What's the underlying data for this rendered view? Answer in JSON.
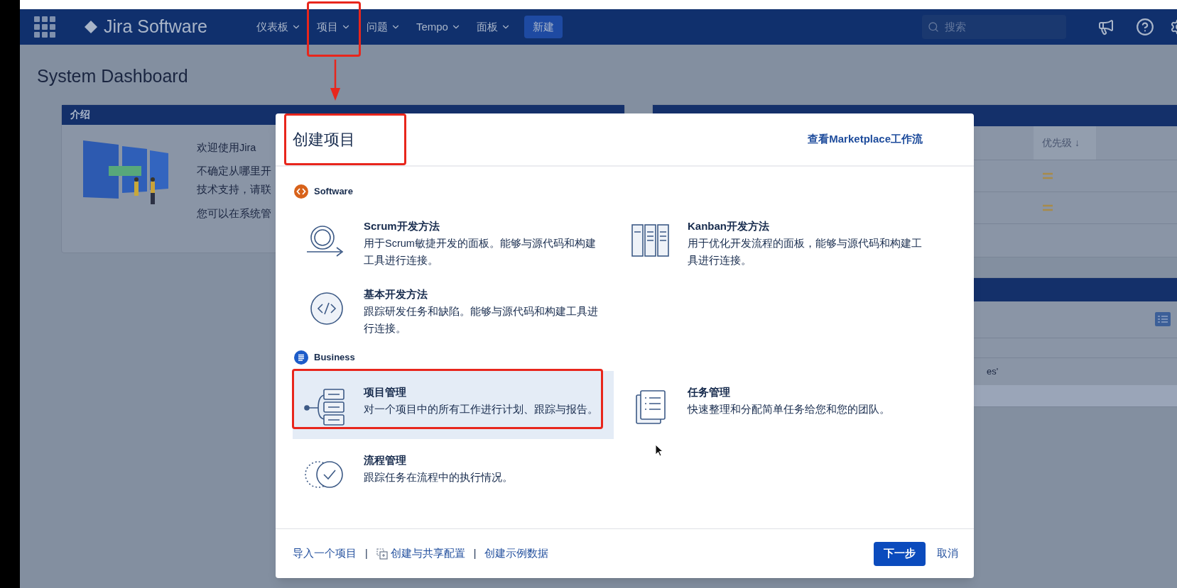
{
  "nav": {
    "app_name": "Jira Software",
    "menus": [
      "仪表板",
      "项目",
      "问题",
      "Tempo",
      "面板"
    ],
    "create_button": "新建",
    "search": {
      "placeholder": "搜索"
    }
  },
  "page": {
    "title": "System Dashboard"
  },
  "intro_card": {
    "title": "介绍",
    "heading": "欢迎使用Jira",
    "lines": [
      "不确定从哪里开",
      "技术支持，请联",
      "您可以在系统管"
    ]
  },
  "issues_card": {
    "column": "优先级 ↓",
    "rows": [
      {
        "kind": "medium"
      },
      {
        "kind": "medium"
      }
    ]
  },
  "activity_card": {
    "snippet": "es'"
  },
  "modal": {
    "title": "创建项目",
    "marketplace_link": "查看Marketplace工作流",
    "sections": [
      {
        "label": "Software",
        "kind": "software",
        "templates": [
          {
            "kind": "scrum",
            "name": "Scrum开发方法",
            "description": "用于Scrum敏捷开发的面板。能够与源代码和构建工具进行连接。",
            "selected": false
          },
          {
            "kind": "kanban",
            "name": "Kanban开发方法",
            "description": "用于优化开发流程的面板，能够与源代码和构建工具进行连接。",
            "selected": false
          },
          {
            "kind": "basic",
            "name": "基本开发方法",
            "description": "跟踪研发任务和缺陷。能够与源代码和构建工具进行连接。",
            "selected": false
          }
        ]
      },
      {
        "label": "Business",
        "kind": "business",
        "templates": [
          {
            "kind": "project",
            "name": "项目管理",
            "description": "对一个项目中的所有工作进行计划、跟踪与报告。",
            "selected": true
          },
          {
            "kind": "task",
            "name": "任务管理",
            "description": "快速整理和分配简单任务给您和您的团队。",
            "selected": false
          },
          {
            "kind": "process",
            "name": "流程管理",
            "description": "跟踪任务在流程中的执行情况。",
            "selected": false
          }
        ]
      }
    ],
    "footer_links": [
      {
        "kind": "link",
        "label": "导入一个项目"
      },
      {
        "kind": "separator",
        "label": "|"
      },
      {
        "kind": "config",
        "label": "创建与共享配置"
      },
      {
        "kind": "separator",
        "label": "|"
      },
      {
        "kind": "link",
        "label": "创建示例数据"
      }
    ],
    "next_button": "下一步",
    "cancel_button": "取消"
  }
}
